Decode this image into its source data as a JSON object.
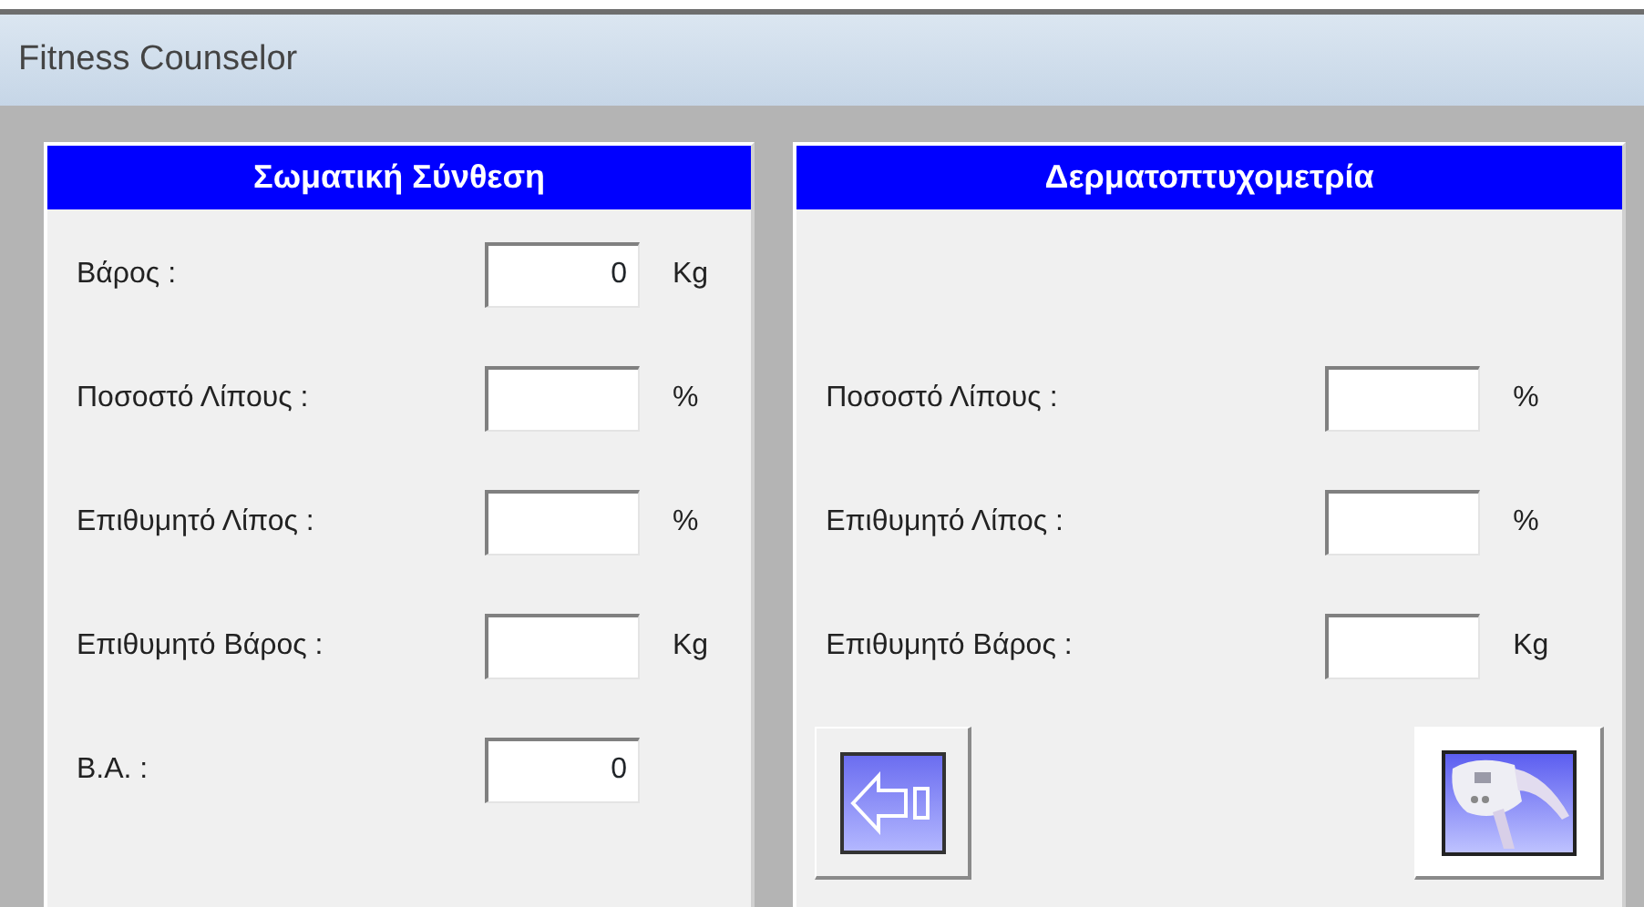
{
  "window": {
    "title": "Fitness Counselor"
  },
  "panels": [
    {
      "title": "Σωματική Σύνθεση",
      "rows": [
        {
          "label": "Βάρος :",
          "value": "0",
          "unit": "Kg"
        },
        {
          "label": "Ποσοστό Λίπους :",
          "unit": "%"
        },
        {
          "label": "Επιθυμητό Λίπος :",
          "unit": "%"
        },
        {
          "label": "Επιθυμητό Βάρος :",
          "unit": "Kg"
        },
        {
          "label": "B.A. :",
          "value": "0"
        }
      ]
    },
    {
      "title": "Δερματοπτυχομετρία",
      "rows": [
        {
          "label": "Ποσοστό Λίπους :",
          "unit": "%"
        },
        {
          "label": "Επιθυμητό Λίπος :",
          "unit": "%"
        },
        {
          "label": "Επιθυμητό Βάρος :",
          "unit": "Kg"
        }
      ],
      "buttons": [
        {
          "kind": "back"
        },
        {
          "kind": "caliper"
        }
      ]
    }
  ]
}
